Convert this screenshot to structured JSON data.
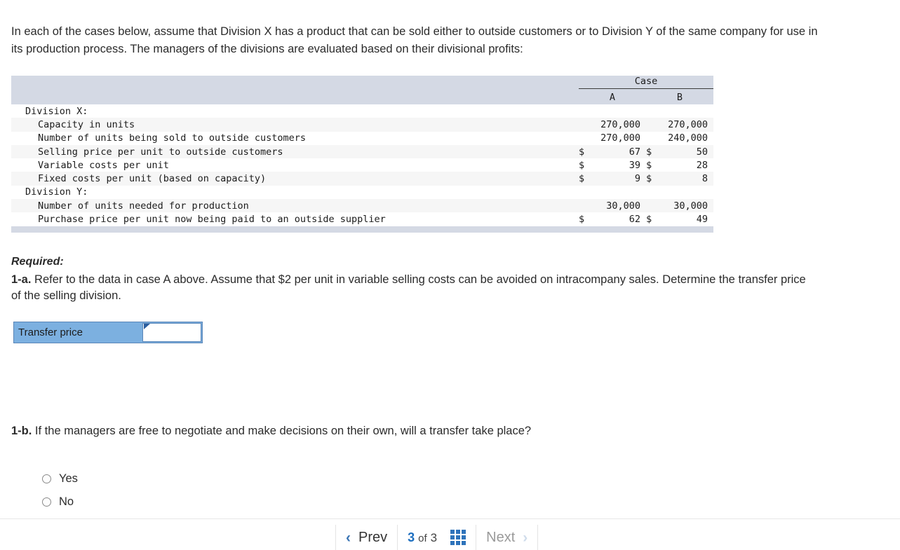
{
  "intro": {
    "paragraph": "In each of the cases below, assume that Division X has a product that can be sold either to outside customers or to Division Y of the same company for use in its production process. The managers of the divisions are evaluated based on their divisional profits:"
  },
  "table": {
    "group_header": "Case",
    "columns": [
      "A",
      "B"
    ],
    "rows": [
      {
        "label": "Division X:",
        "indent": false,
        "currency": [
          "",
          ""
        ],
        "values": [
          "",
          ""
        ]
      },
      {
        "label": "Capacity in units",
        "indent": true,
        "currency": [
          "",
          ""
        ],
        "values": [
          "270,000",
          "270,000"
        ]
      },
      {
        "label": "Number of units being sold to outside customers",
        "indent": true,
        "currency": [
          "",
          ""
        ],
        "values": [
          "270,000",
          "240,000"
        ]
      },
      {
        "label": "Selling price per unit to outside customers",
        "indent": true,
        "currency": [
          "$",
          "$"
        ],
        "values": [
          "67",
          "50"
        ]
      },
      {
        "label": "Variable costs per unit",
        "indent": true,
        "currency": [
          "$",
          "$"
        ],
        "values": [
          "39",
          "28"
        ]
      },
      {
        "label": "Fixed costs per unit (based on capacity)",
        "indent": true,
        "currency": [
          "$",
          "$"
        ],
        "values": [
          "9",
          "8"
        ]
      },
      {
        "label": "Division Y:",
        "indent": false,
        "currency": [
          "",
          ""
        ],
        "values": [
          "",
          ""
        ]
      },
      {
        "label": "Number of units needed for production",
        "indent": true,
        "currency": [
          "",
          ""
        ],
        "values": [
          "30,000",
          "30,000"
        ]
      },
      {
        "label": "Purchase price per unit now being paid to an outside supplier",
        "indent": true,
        "currency": [
          "$",
          "$"
        ],
        "values": [
          "62",
          "49"
        ]
      }
    ]
  },
  "required": {
    "title": "Required:",
    "q1a_label": "1-a.",
    "q1a_text": " Refer to the data in case A above. Assume that $2 per unit in variable selling costs can be avoided on intracompany sales. Determine the transfer price of the selling division.",
    "q1b_label": "1-b.",
    "q1b_text": " If the managers are free to negotiate and make decisions on their own, will a transfer take place?"
  },
  "answer": {
    "label": "Transfer price",
    "value": "",
    "placeholder": ""
  },
  "choices": {
    "yes": "Yes",
    "no": "No"
  },
  "nav": {
    "prev_label": "Prev",
    "next_label": "Next",
    "prev_chevron": "‹",
    "next_chevron": "›",
    "current_page": "3",
    "of_label": "of",
    "total_pages": "3"
  },
  "colors": {
    "table_band": "#d4d9e4",
    "answer_blue": "#7cb0e0",
    "accent_blue": "#2f74bb",
    "stripe": "#f6f6f6"
  }
}
